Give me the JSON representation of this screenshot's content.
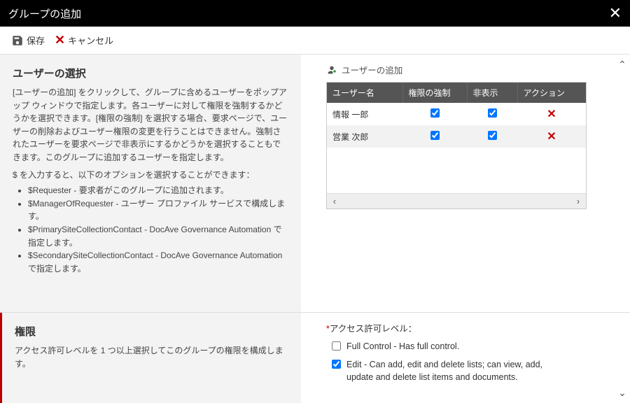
{
  "title": "グループの追加",
  "toolbar": {
    "save_label": "保存",
    "cancel_label": "キャンセル"
  },
  "section1": {
    "heading": "ユーザーの選択",
    "desc": "[ユーザーの追加] をクリックして、グループに含めるユーザーをポップアップ ウィンドウで指定します。各ユーザーに対して権限を強制するかどうかを選択できます。[権限の強制] を選択する場合、要求ページで、ユーザーの削除およびユーザー権限の変更を行うことはできません。強制されたユーザーを要求ページで非表示にするかどうかを選択することもできます。このグループに追加するユーザーを指定します。",
    "opt_intro": "$ を入力すると、以下のオプションを選択することができます：",
    "options": [
      "$Requester - 要求者がこのグループに追加されます。",
      "$ManagerOfRequester - ユーザー プロファイル サービスで構成します。",
      "$PrimarySiteCollectionContact - DocAve Governance Automation で指定します。",
      "$SecondarySiteCollectionContact - DocAve Governance Automation で指定します。"
    ]
  },
  "add_user_label": "ユーザーの追加",
  "table": {
    "headers": [
      "ユーザー名",
      "権限の強制",
      "非表示",
      "アクション"
    ],
    "rows": [
      {
        "name": "情報 一郎",
        "enforced": true,
        "hidden": true
      },
      {
        "name": "営業 次郎",
        "enforced": true,
        "hidden": true
      }
    ]
  },
  "section2": {
    "heading": "権限",
    "desc": "アクセス許可レベルを 1 つ以上選択してこのグループの権限を構成します。",
    "right_label": "アクセス許可レベル：",
    "perms": [
      {
        "label": "Full Control - Has full control.",
        "checked": false
      },
      {
        "label": "Edit - Can add, edit and delete lists; can view, add, update and delete list items and documents.",
        "checked": true
      }
    ]
  }
}
